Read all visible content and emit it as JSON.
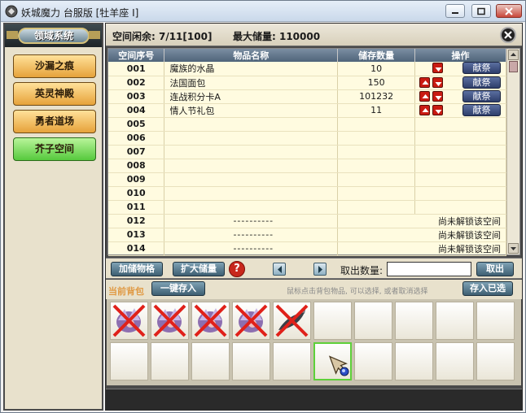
{
  "window": {
    "title": "妖城魔力 台服版 [牡羊座 I]",
    "buttons": [
      "minimize",
      "maximize",
      "close"
    ]
  },
  "sidebar": {
    "header": "领域系统",
    "items": [
      {
        "label": "沙漏之痕",
        "active": false
      },
      {
        "label": "英灵神殿",
        "active": false
      },
      {
        "label": "勇者道场",
        "active": false
      },
      {
        "label": "芥子空间",
        "active": true
      }
    ]
  },
  "info": {
    "space_free": "空间闲余: 7/11[100]",
    "max_storage": "最大储量: 110000"
  },
  "table": {
    "headers": [
      "空间序号",
      "物品名称",
      "储存数量",
      "操作"
    ],
    "rows": [
      {
        "idx": "001",
        "name": "魔族的水晶",
        "qty": "10",
        "up": false,
        "down": true,
        "gift": "献祭"
      },
      {
        "idx": "002",
        "name": "法国面包",
        "qty": "150",
        "up": true,
        "down": true,
        "gift": "献祭"
      },
      {
        "idx": "003",
        "name": "连战积分卡A",
        "qty": "101232",
        "up": true,
        "down": true,
        "gift": "献祭"
      },
      {
        "idx": "004",
        "name": "情人节礼包",
        "qty": "11",
        "up": true,
        "down": true,
        "gift": "献祭"
      },
      {
        "idx": "005"
      },
      {
        "idx": "006"
      },
      {
        "idx": "007"
      },
      {
        "idx": "008"
      },
      {
        "idx": "009"
      },
      {
        "idx": "010"
      },
      {
        "idx": "011"
      }
    ],
    "locked_rows": [
      {
        "idx": "012",
        "name": "----------",
        "msg": "尚未解锁该空间"
      },
      {
        "idx": "013",
        "name": "----------",
        "msg": "尚未解锁该空间"
      },
      {
        "idx": "014",
        "name": "----------",
        "msg": "尚未解锁该空间"
      }
    ]
  },
  "controls": {
    "add_item": "加储物格",
    "expand": "扩大储量",
    "help": "?",
    "qty_label": "取出数量:",
    "qty_value": "",
    "take_out": "取出"
  },
  "bag": {
    "label": "当前背包",
    "store_all": "一键存入",
    "hint": "鼠标点击背包物品, 可以选择, 或者取消选择",
    "store_selected": "存入已选",
    "slots_row1": [
      "crystal",
      "crystal",
      "crystal",
      "crystal",
      "fish",
      "",
      "",
      "",
      "",
      ""
    ],
    "slots_row2": [
      "",
      "",
      "",
      "",
      "",
      "cursor",
      "",
      "",
      "",
      ""
    ]
  },
  "colors": {
    "nav_active": "#56c93d",
    "nav": "#e6a23a",
    "header_blue": "#4f647a",
    "danger_red": "#c91b12"
  }
}
